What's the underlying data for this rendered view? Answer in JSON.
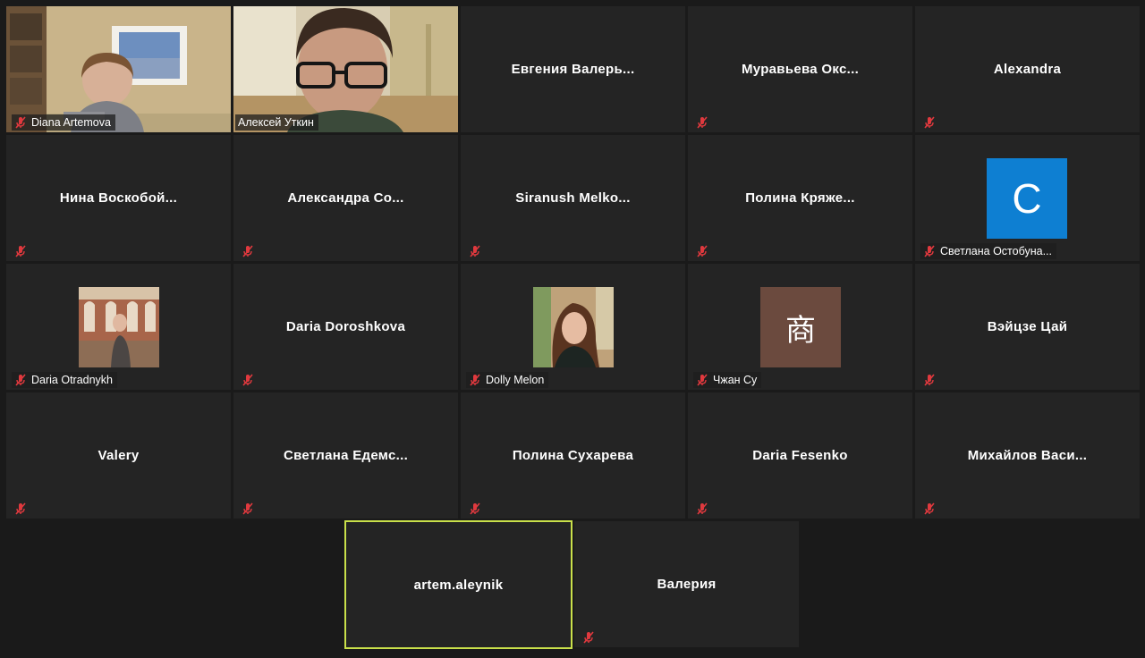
{
  "participants": [
    {
      "display": "Diana Artemova"
    },
    {
      "display": "Алексей Уткин"
    },
    {
      "display": "Евгения  Валерь..."
    },
    {
      "display": "Муравьева  Окс..."
    },
    {
      "display": "Alexandra"
    },
    {
      "display": "Нина  Воскобой..."
    },
    {
      "display": "Александра  Со..."
    },
    {
      "display": "Siranush  Melko..."
    },
    {
      "display": "Полина  Кряже..."
    },
    {
      "display": "Светлана Остобуна...",
      "avatar_letter": "C",
      "avatar_color": "#0e7fd2"
    },
    {
      "display": "Daria Otradnykh"
    },
    {
      "display": "Daria Doroshkova"
    },
    {
      "display": "Dolly Melon"
    },
    {
      "display": "Чжан Су",
      "avatar_letter": "商",
      "avatar_color": "#6b4a3e"
    },
    {
      "display": "Вэйцзе Цай"
    },
    {
      "display": "Valery"
    },
    {
      "display": "Светлана  Едемс..."
    },
    {
      "display": "Полина Сухарева"
    },
    {
      "display": "Daria Fesenko"
    },
    {
      "display": "Михайлов  Васи..."
    },
    {
      "display": "artem.aleynik"
    },
    {
      "display": "Валерия"
    }
  ],
  "colors": {
    "active_speaker_border": "#c9e04a",
    "mute_icon": "#e0393e",
    "tile_bg": "#242424",
    "page_bg": "#1a1a1a"
  }
}
